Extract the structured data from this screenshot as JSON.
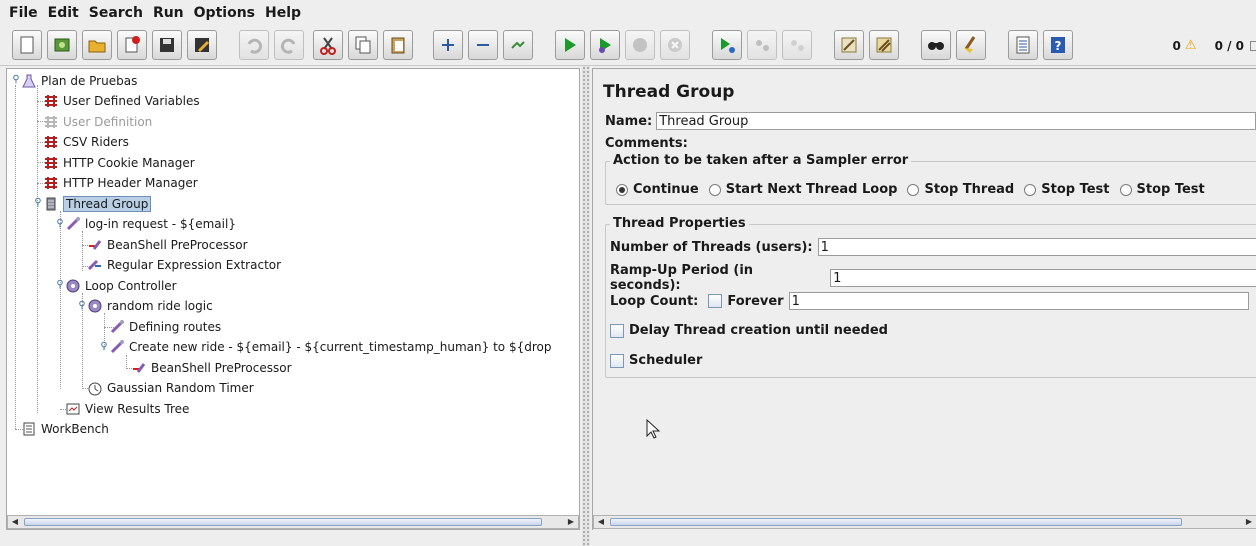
{
  "menu": {
    "file": "File",
    "edit": "Edit",
    "search": "Search",
    "run": "Run",
    "options": "Options",
    "help": "Help"
  },
  "toolbar": {
    "error_count": "0",
    "threads_count": "0 / 0",
    "icons": [
      "new-icon",
      "templates-icon",
      "open-icon",
      "close-icon",
      "save-icon",
      "save-as-icon",
      "undo-icon",
      "redo-icon",
      "cut-icon",
      "copy-icon",
      "paste-icon",
      "expand-icon",
      "collapse-icon",
      "toggle-icon",
      "start-icon",
      "start-no-pauses-icon",
      "stop-icon",
      "shutdown-icon",
      "remote-start-icon",
      "remote-stop-icon",
      "remote-shutdown-icon",
      "clear-icon",
      "clear-all-icon",
      "search-icon",
      "reset-search-icon",
      "function-helper-icon",
      "help-icon"
    ]
  },
  "tree": {
    "items": [
      {
        "label": "Plan de Pruebas",
        "icon": "test-plan-icon"
      },
      {
        "label": "User Defined Variables",
        "icon": "config-element-icon"
      },
      {
        "label": "User Definition",
        "icon": "config-element-icon",
        "disabled": true
      },
      {
        "label": "CSV Riders",
        "icon": "config-element-icon"
      },
      {
        "label": "HTTP Cookie Manager",
        "icon": "config-element-icon"
      },
      {
        "label": "HTTP Header Manager",
        "icon": "config-element-icon"
      },
      {
        "label": "Thread Group",
        "icon": "thread-group-icon",
        "selected": true
      },
      {
        "label": "log-in request - ${email}",
        "icon": "sampler-icon"
      },
      {
        "label": "BeanShell PreProcessor",
        "icon": "preprocessor-icon"
      },
      {
        "label": "Regular Expression Extractor",
        "icon": "postprocessor-icon"
      },
      {
        "label": "Loop Controller",
        "icon": "controller-icon"
      },
      {
        "label": "random ride logic",
        "icon": "controller-icon"
      },
      {
        "label": "Defining routes",
        "icon": "sampler-icon"
      },
      {
        "label": "Create new ride - ${email} -  ${current_timestamp_human} to ${drop",
        "icon": "sampler-icon"
      },
      {
        "label": "BeanShell PreProcessor",
        "icon": "preprocessor-icon"
      },
      {
        "label": "Gaussian Random Timer",
        "icon": "timer-icon"
      },
      {
        "label": "View Results Tree",
        "icon": "listener-icon"
      },
      {
        "label": "WorkBench",
        "icon": "workbench-icon"
      }
    ]
  },
  "panel": {
    "title": "Thread Group",
    "name_label": "Name:",
    "name_value": "Thread Group",
    "comments_label": "Comments:",
    "sampler_error": {
      "title": "Action to be taken after a Sampler error",
      "options": [
        "Continue",
        "Start Next Thread Loop",
        "Stop Thread",
        "Stop Test",
        "Stop Test"
      ],
      "selected": "Continue"
    },
    "thread_props": {
      "title": "Thread Properties",
      "threads_label": "Number of Threads (users):",
      "threads_value": "1",
      "rampup_label": "Ramp-Up Period (in seconds):",
      "rampup_value": "1",
      "loop_label": "Loop Count:",
      "forever_label": "Forever",
      "loop_value": "1",
      "delay_label": "Delay Thread creation until needed",
      "scheduler_label": "Scheduler"
    }
  }
}
